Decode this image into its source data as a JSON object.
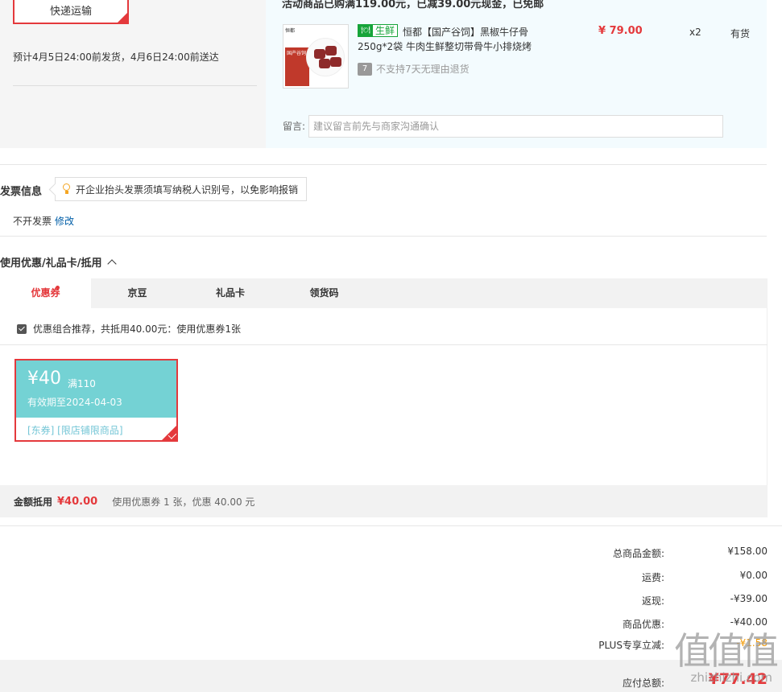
{
  "shipping": {
    "method_label": "快递运输",
    "eta_text": "预计4月5日24:00前发货，4月6日24:00前送达"
  },
  "product": {
    "promo_text": "活动商品已购满119.00元，已减39.00元现金，已免邮",
    "thumb_brand": "恒都",
    "thumb_panel_text": "国产谷饲",
    "fresh_tag": "生鲜",
    "title": "恒都【国产谷饲】黑椒牛仔骨250g*2袋 牛肉生鲜整切带骨牛小排烧烤",
    "no_return_icon": "7",
    "no_return_text": "不支持7天无理由退货",
    "price": "¥ 79.00",
    "quantity": "x2",
    "stock": "有货",
    "note_label": "留言:",
    "note_placeholder": "建议留言前先与商家沟通确认"
  },
  "invoice": {
    "title": "发票信息",
    "tip": "开企业抬头发票须填写纳税人识别号，以免影响报销",
    "status": "不开发票",
    "edit_label": "修改"
  },
  "coupons": {
    "section_title": "使用优惠/礼品卡/抵用",
    "tabs": [
      {
        "label": "优惠券",
        "active": true
      },
      {
        "label": "京豆",
        "active": false
      },
      {
        "label": "礼品卡",
        "active": false
      },
      {
        "label": "领货码",
        "active": false
      }
    ],
    "combo_text": "优惠组合推荐，共抵用40.00元：使用优惠券1张",
    "coupon": {
      "amount": "¥40",
      "condition": "满110",
      "validity": "有效期至2024-04-03",
      "scope": "[东券]  [限店铺限商品]",
      "selected": true
    },
    "summary_label": "金额抵用",
    "summary_amount": "¥40.00",
    "summary_desc": "使用优惠券 1 张，优惠 40.00 元"
  },
  "totals": {
    "rows": [
      {
        "label": "总商品金额:",
        "value": "¥158.00"
      },
      {
        "label": "运费:",
        "value": "¥0.00"
      },
      {
        "label": "返现:",
        "value": "-¥39.00"
      },
      {
        "label": "商品优惠:",
        "value": "-¥40.00"
      },
      {
        "label": "PLUS专享立减:",
        "value": "-¥1.58"
      }
    ],
    "payable_label": "应付总额:",
    "payable_value": "¥77.42"
  },
  "watermark": {
    "glyphs": "值值值",
    "site": "zhizhizhi.com"
  },
  "colors": {
    "accent": "#e4393c",
    "coupon_teal": "#74d2d4",
    "fresh_green": "#16a43a",
    "link_blue": "#005ea7",
    "orange": "#f39800"
  }
}
